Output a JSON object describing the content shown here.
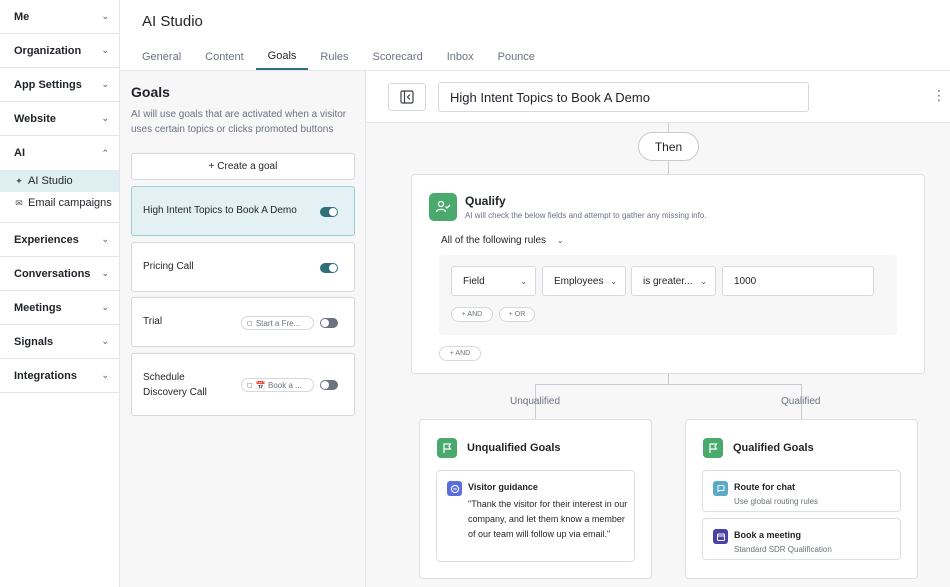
{
  "sidebar": {
    "sections_top": [
      {
        "label": "Me"
      },
      {
        "label": "Organization"
      },
      {
        "label": "App Settings"
      },
      {
        "label": "Website"
      }
    ],
    "ai": {
      "label": "AI",
      "items": [
        {
          "label": "AI Studio",
          "icon": "sparkle-icon",
          "active": true
        },
        {
          "label": "Email campaigns",
          "icon": "mail-icon",
          "active": false
        }
      ]
    },
    "sections_bottom": [
      {
        "label": "Experiences"
      },
      {
        "label": "Conversations"
      },
      {
        "label": "Meetings"
      },
      {
        "label": "Signals"
      },
      {
        "label": "Integrations"
      }
    ]
  },
  "header": {
    "title": "AI Studio",
    "tabs": [
      {
        "label": "General"
      },
      {
        "label": "Content"
      },
      {
        "label": "Goals",
        "active": true
      },
      {
        "label": "Rules"
      },
      {
        "label": "Scorecard"
      },
      {
        "label": "Inbox"
      },
      {
        "label": "Pounce"
      }
    ]
  },
  "goals_panel": {
    "title": "Goals",
    "description": "AI will use goals that are activated when a visitor uses certain topics or clicks promoted buttons",
    "create_label": "+ Create a goal",
    "goals": [
      {
        "name": "High Intent Topics to Book A Demo",
        "chip": "",
        "enabled": true,
        "selected": true
      },
      {
        "name": "Pricing Call",
        "chip": "",
        "enabled": true,
        "selected": false
      },
      {
        "name": "Trial",
        "chip": "Start a Fre...",
        "enabled": false,
        "selected": false
      },
      {
        "name": "Schedule Discovery Call",
        "chip": "📅 Book a ...",
        "enabled": false,
        "selected": false
      }
    ]
  },
  "canvas": {
    "goal_title": "High Intent Topics to Book A Demo",
    "then_label": "Then",
    "qualify": {
      "title": "Qualify",
      "description": "AI will check the below fields and attempt to gather any missing info.",
      "rules_mode": "All of the following rules",
      "rule": {
        "field": "Field",
        "attribute": "Employees",
        "operator": "is greater...",
        "value": "1000"
      },
      "and_label": "+ AND",
      "or_label": "+ OR",
      "outer_and_label": "+ AND"
    },
    "unqualified_label": "Unqualified",
    "qualified_label": "Qualified",
    "unqualified_goals": {
      "title": "Unqualified Goals",
      "card": {
        "title": "Visitor guidance",
        "body": "\"Thank the visitor for their interest in our company, and let them know a member of our team will follow up via email.\""
      }
    },
    "qualified_goals": {
      "title": "Qualified Goals",
      "cards": [
        {
          "title": "Route for chat",
          "sub": "Use global routing rules",
          "icon": "chat-route-icon"
        },
        {
          "title": "Book a meeting",
          "sub": "Standard SDR Qualification",
          "icon": "calendar-icon"
        }
      ]
    }
  },
  "colors": {
    "accent": "#2f6f7c",
    "green": "#4aa96c",
    "selected_bg": "#e3f1f4"
  }
}
